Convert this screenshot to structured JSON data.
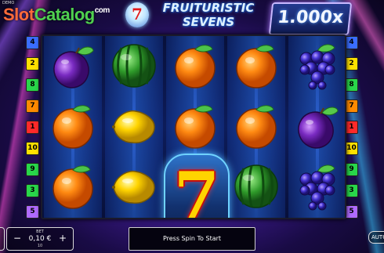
{
  "demo_label": "DEMO",
  "watermark": {
    "part1": "Slot",
    "part2": "Catalog",
    "suffix": "com"
  },
  "logo": {
    "seven": "7",
    "line1": "FRUITURISTIC",
    "line2": "SEVENS"
  },
  "multiplier": "1.000x",
  "paylines_left": [
    {
      "n": "4",
      "color": "#3a6dff"
    },
    {
      "n": "2",
      "color": "#ffe100"
    },
    {
      "n": "8",
      "color": "#29d64a"
    },
    {
      "n": "7",
      "color": "#ff8a00"
    },
    {
      "n": "1",
      "color": "#ff2a2a"
    },
    {
      "n": "10",
      "color": "#ffe100"
    },
    {
      "n": "9",
      "color": "#29d64a"
    },
    {
      "n": "3",
      "color": "#29d64a"
    },
    {
      "n": "5",
      "color": "#b06aff"
    }
  ],
  "paylines_right": [
    {
      "n": "4",
      "color": "#3a6dff"
    },
    {
      "n": "2",
      "color": "#ffe100"
    },
    {
      "n": "8",
      "color": "#29d64a"
    },
    {
      "n": "7",
      "color": "#ff8a00"
    },
    {
      "n": "1",
      "color": "#ff2a2a"
    },
    {
      "n": "10",
      "color": "#ffe100"
    },
    {
      "n": "9",
      "color": "#29d64a"
    },
    {
      "n": "3",
      "color": "#29d64a"
    },
    {
      "n": "5",
      "color": "#b06aff"
    }
  ],
  "reels": [
    [
      "plum",
      "orange",
      "orange"
    ],
    [
      "watermelon",
      "lemon",
      "lemon"
    ],
    [
      "orange",
      "orange",
      "seven"
    ],
    [
      "orange",
      "orange",
      "watermelon"
    ],
    [
      "grape",
      "plum",
      "grape"
    ]
  ],
  "bet": {
    "label": "BET",
    "value": "0,10 €",
    "sub": "10",
    "minus": "−",
    "plus": "+"
  },
  "message": "Press Spin To Start",
  "auto_label": "AUTO"
}
